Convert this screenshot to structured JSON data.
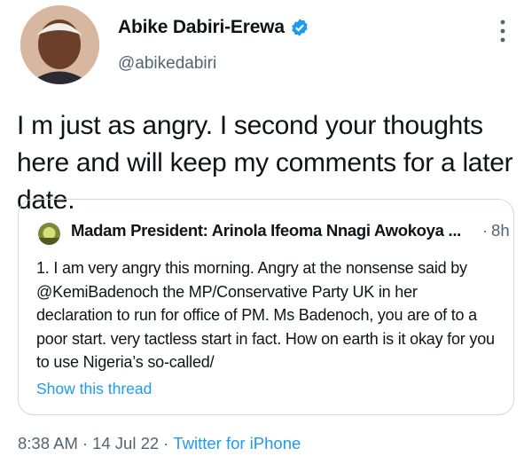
{
  "author": {
    "display_name": "Abike Dabiri-Erewa",
    "handle": "@abikedabiri",
    "verified_icon": "verified-badge-icon"
  },
  "tweet": {
    "text": "I m just as angry. I second your thoughts here and will keep my comments for a later date."
  },
  "quote": {
    "author_name": "Madam President: Arinola Ifeoma Nnagi Awokoya ...",
    "separator": "·",
    "time": "8h",
    "text": "1. I am very angry this morning. Angry at the nonsense said by @KemiBadenoch the MP/Conservative Party UK in her declaration to run for office of PM. Ms Badenoch, you are of to a poor start. very tactless start in fact. How on earth is it okay for you to use Nigeria’s so-called/",
    "show_thread": "Show this thread"
  },
  "meta": {
    "time": "8:38 AM",
    "date": "14 Jul 22",
    "source": "Twitter for iPhone",
    "separator": "·"
  },
  "colors": {
    "link": "#1d9bf0",
    "secondary_text": "#536471",
    "border": "#cfd9de"
  }
}
